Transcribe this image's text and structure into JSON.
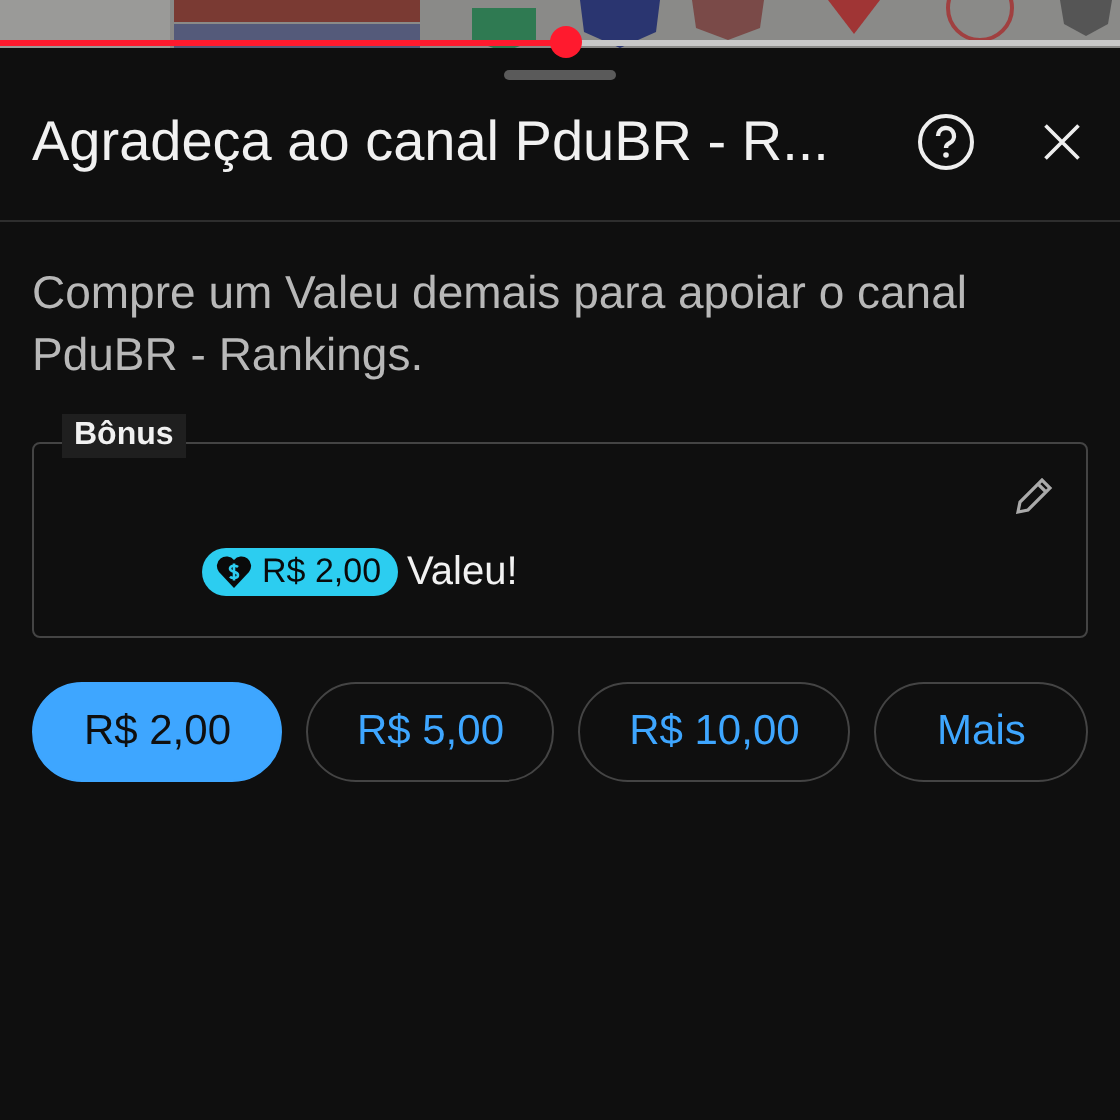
{
  "video": {
    "kind": "picture",
    "progress": {
      "level": 0.505
    }
  },
  "dialog": {
    "title": "Agradeça ao canal PduBR - R...",
    "description": "Compre um Valeu demais para apoiar o canal PduBR - Rankings.",
    "bonus": {
      "label": "Bônus",
      "amount": "R$ 2,00",
      "message": "Valeu!"
    },
    "amounts": [
      {
        "label": "R$ 2,00",
        "selected": true
      },
      {
        "label": "R$ 5,00",
        "selected": false
      },
      {
        "label": "R$ 10,00",
        "selected": false
      },
      {
        "label": "Mais",
        "selected": false
      }
    ]
  }
}
